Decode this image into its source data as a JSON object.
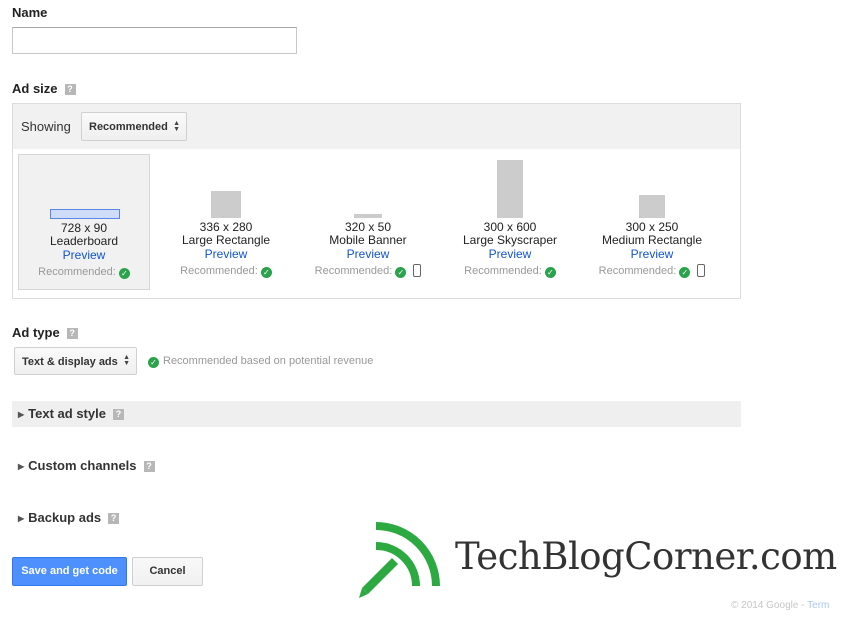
{
  "name_section": {
    "label": "Name",
    "input_value": ""
  },
  "ad_size": {
    "label": "Ad size",
    "help": "?",
    "showing_label": "Showing",
    "showing_value": "Recommended",
    "cards": [
      {
        "dims": "728 x 90",
        "name": "Leaderboard",
        "preview": "Preview",
        "recommended": "Recommended:",
        "mobile": false,
        "selected": true
      },
      {
        "dims": "336 x 280",
        "name": "Large Rectangle",
        "preview": "Preview",
        "recommended": "Recommended:",
        "mobile": false,
        "selected": false
      },
      {
        "dims": "320 x 50",
        "name": "Mobile Banner",
        "preview": "Preview",
        "recommended": "Recommended:",
        "mobile": true,
        "selected": false
      },
      {
        "dims": "300 x 600",
        "name": "Large Skyscraper",
        "preview": "Preview",
        "recommended": "Recommended:",
        "mobile": false,
        "selected": false
      },
      {
        "dims": "300 x 250",
        "name": "Medium Rectangle",
        "preview": "Preview",
        "recommended": "Recommended:",
        "mobile": true,
        "selected": false
      }
    ]
  },
  "ad_type": {
    "label": "Ad type",
    "help": "?",
    "select_value": "Text & display ads",
    "note": "Recommended based on potential revenue"
  },
  "sections": {
    "text_ad_style": "Text ad style",
    "custom_channels": "Custom channels",
    "backup_ads": "Backup ads",
    "help": "?"
  },
  "buttons": {
    "save": "Save and get code",
    "cancel": "Cancel"
  },
  "footer": {
    "copyright": "© 2014 Google -",
    "terms": "Term"
  },
  "watermark": {
    "text": "TechBlogCorner.com"
  },
  "colors": {
    "primary_blue": "#4d90fe",
    "link_blue": "#1155cc",
    "check_green": "#2ba24c",
    "watermark_green": "#2da942"
  }
}
